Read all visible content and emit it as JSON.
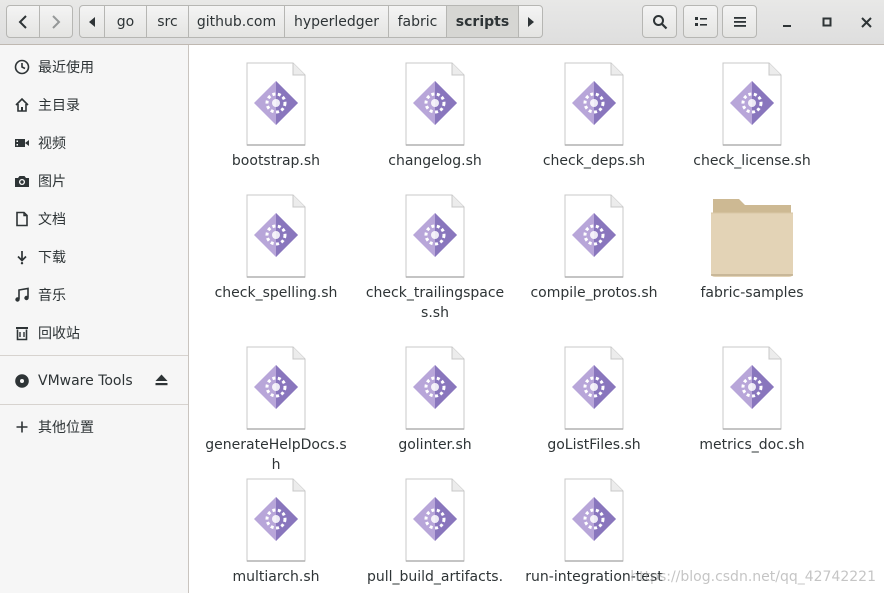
{
  "header": {
    "back_icon": "chevron-left-icon",
    "forward_icon": "chevron-right-icon",
    "breadcrumbs": [
      "go",
      "src",
      "github.com",
      "hyperledger",
      "fabric",
      "scripts"
    ],
    "active_crumb": "scripts",
    "search_icon": "search-icon",
    "view_toggle_icon": "list-view-icon",
    "menu_icon": "hamburger-menu-icon",
    "window_controls": [
      "minimize",
      "maximize",
      "close"
    ]
  },
  "sidebar": {
    "items": [
      {
        "label": "最近使用",
        "icon": "clock-icon"
      },
      {
        "label": "主目录",
        "icon": "home-icon"
      },
      {
        "label": "视频",
        "icon": "video-icon"
      },
      {
        "label": "图片",
        "icon": "camera-icon"
      },
      {
        "label": "文档",
        "icon": "document-icon"
      },
      {
        "label": "下载",
        "icon": "download-icon"
      },
      {
        "label": "音乐",
        "icon": "music-icon"
      },
      {
        "label": "回收站",
        "icon": "trash-icon"
      }
    ],
    "devices": [
      {
        "label": "VMware Tools",
        "icon": "disc-icon",
        "action_icon": "eject-icon"
      }
    ],
    "other": {
      "label": "其他位置",
      "icon": "plus-icon"
    }
  },
  "files": [
    {
      "name": "bootstrap.sh",
      "type": "script"
    },
    {
      "name": "changelog.sh",
      "type": "script"
    },
    {
      "name": "check_deps.sh",
      "type": "script"
    },
    {
      "name": "check_license.sh",
      "type": "script"
    },
    {
      "name": "check_spelling.sh",
      "type": "script"
    },
    {
      "name": "check_trailingspaces.sh",
      "type": "script"
    },
    {
      "name": "compile_protos.sh",
      "type": "script"
    },
    {
      "name": "fabric-samples",
      "type": "folder"
    },
    {
      "name": "generateHelpDocs.sh",
      "type": "script"
    },
    {
      "name": "golinter.sh",
      "type": "script"
    },
    {
      "name": "goListFiles.sh",
      "type": "script"
    },
    {
      "name": "metrics_doc.sh",
      "type": "script"
    },
    {
      "name": "multiarch.sh",
      "type": "script"
    },
    {
      "name": "pull_build_artifacts.",
      "type": "script"
    },
    {
      "name": "run-integration-tests.",
      "type": "script"
    }
  ],
  "watermark": "https://blog.csdn.net/qq_42742221",
  "colors": {
    "script_icon_light": "#b8a6d9",
    "script_icon_dark": "#7a66b3",
    "folder": "#e3d3b6",
    "folder_tab": "#cdb993"
  }
}
